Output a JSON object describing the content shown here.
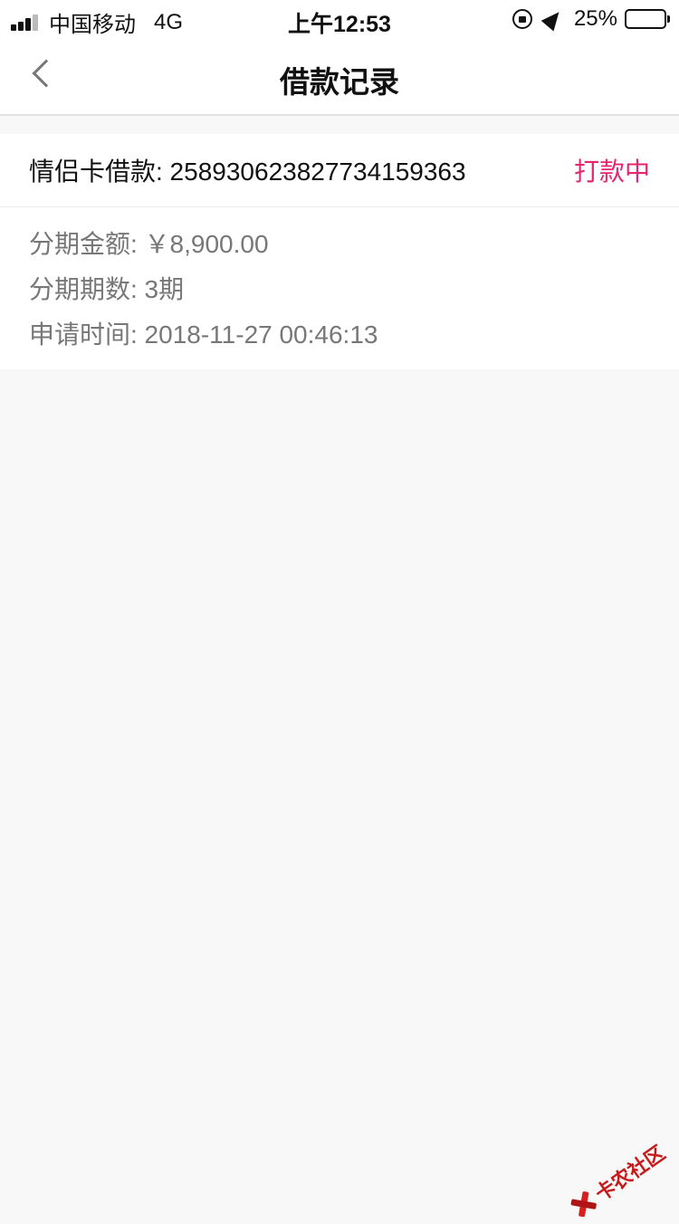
{
  "status_bar": {
    "carrier": "中国移动",
    "network": "4G",
    "time": "上午12:53",
    "battery": "25%",
    "battery_level": 0.25
  },
  "nav": {
    "title": "借款记录",
    "back_icon": "chevron-left-icon"
  },
  "record": {
    "loan_id": "情侣卡借款: 258930623827734159363",
    "status": "打款中",
    "status_color": "#e5266e",
    "amount": "分期金额: ￥8,900.00",
    "periods": "分期期数: 3期",
    "apply_time": "申请时间: 2018-11-27 00:46:13"
  },
  "watermark": {
    "text": "卡农社区"
  }
}
